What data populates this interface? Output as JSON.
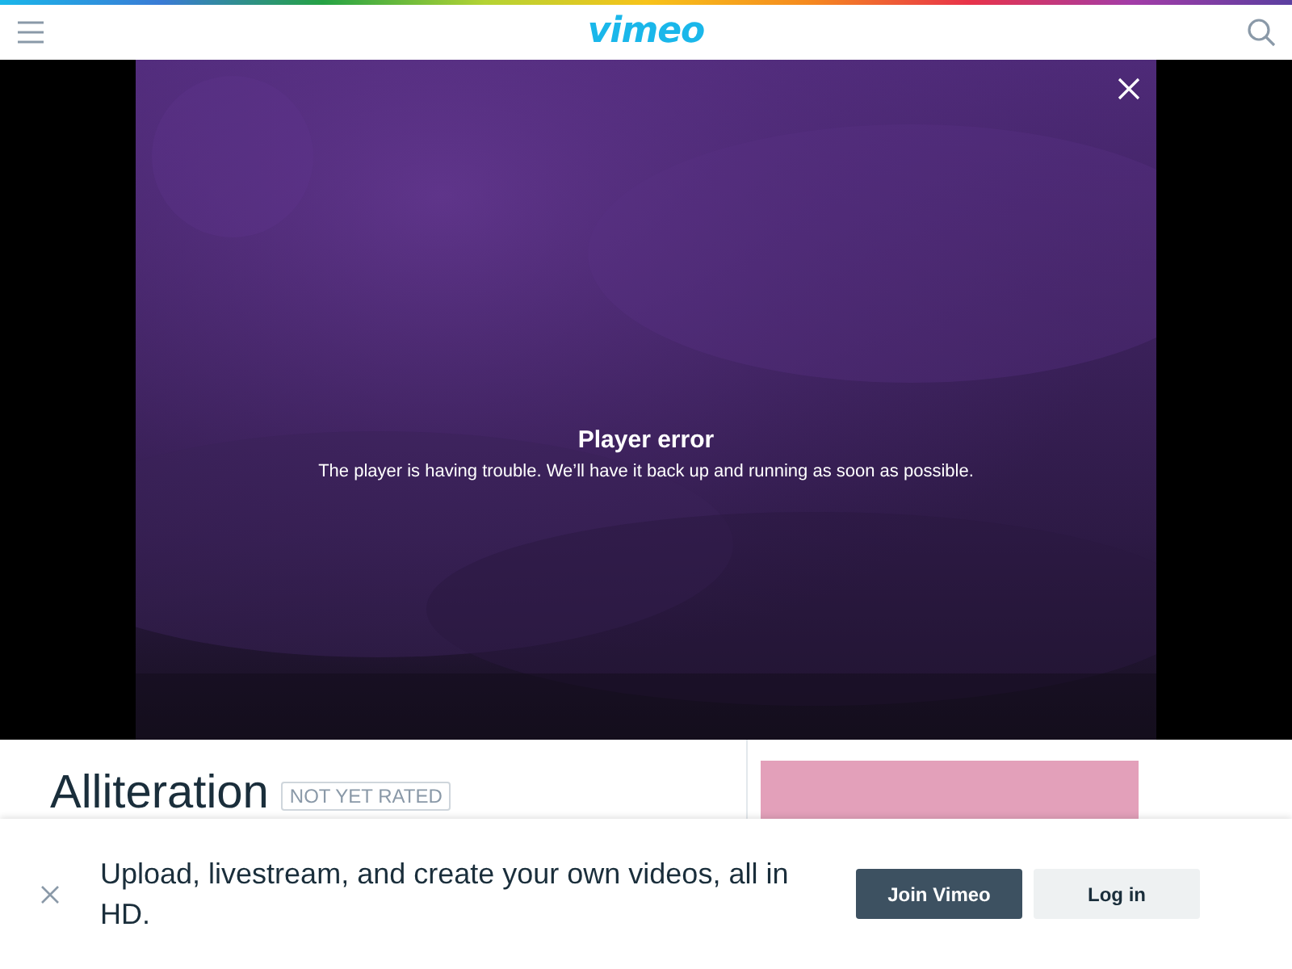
{
  "header": {
    "logo": "vimeo"
  },
  "player": {
    "error_title": "Player error",
    "error_message": "The player is having trouble. We’ll have it back up and running as soon as possible."
  },
  "video": {
    "title": "Alliteration",
    "rating": "NOT YET RATED"
  },
  "banner": {
    "message": "Upload, livestream, and create your own videos, all in HD.",
    "buttons": [
      {
        "label": "Join Vimeo",
        "kind": "primary"
      },
      {
        "label": "Log in",
        "kind": "secondary"
      }
    ]
  }
}
